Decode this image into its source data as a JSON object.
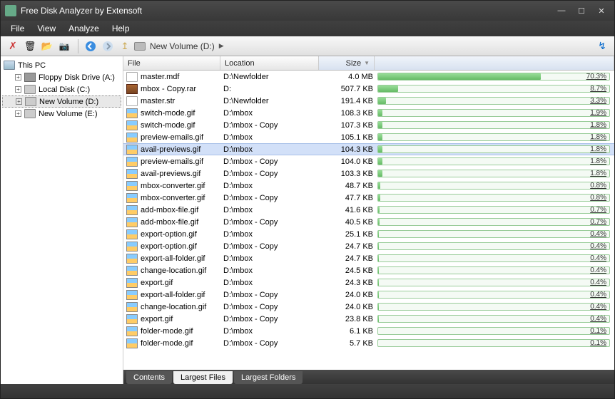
{
  "window": {
    "title": "Free Disk Analyzer by Extensoft"
  },
  "menu": {
    "file": "File",
    "view": "View",
    "analyze": "Analyze",
    "help": "Help"
  },
  "breadcrumb": {
    "path": "New Volume (D:)"
  },
  "tree": {
    "root": "This PC",
    "nodes": [
      {
        "label": "Floppy Disk Drive (A:)"
      },
      {
        "label": "Local Disk (C:)"
      },
      {
        "label": "New Volume (D:)"
      },
      {
        "label": "New Volume (E:)"
      }
    ]
  },
  "columns": {
    "file": "File",
    "location": "Location",
    "size": "Size"
  },
  "tabs": {
    "contents": "Contents",
    "largest_files": "Largest Files",
    "largest_folders": "Largest Folders"
  },
  "files": [
    {
      "icon": "doc",
      "name": "master.mdf",
      "location": "D:\\Newfolder",
      "size": "4.0 MB",
      "pct": 70.3
    },
    {
      "icon": "rar",
      "name": "mbox - Copy.rar",
      "location": "D:",
      "size": "507.7 KB",
      "pct": 8.7
    },
    {
      "icon": "doc",
      "name": "master.str",
      "location": "D:\\Newfolder",
      "size": "191.4 KB",
      "pct": 3.3
    },
    {
      "icon": "gif",
      "name": "switch-mode.gif",
      "location": "D:\\mbox",
      "size": "108.3 KB",
      "pct": 1.9
    },
    {
      "icon": "gif",
      "name": "switch-mode.gif",
      "location": "D:\\mbox - Copy",
      "size": "107.3 KB",
      "pct": 1.8
    },
    {
      "icon": "gif",
      "name": "preview-emails.gif",
      "location": "D:\\mbox",
      "size": "105.1 KB",
      "pct": 1.8
    },
    {
      "icon": "gif",
      "name": "avail-previews.gif",
      "location": "D:\\mbox",
      "size": "104.3 KB",
      "pct": 1.8,
      "selected": true
    },
    {
      "icon": "gif",
      "name": "preview-emails.gif",
      "location": "D:\\mbox - Copy",
      "size": "104.0 KB",
      "pct": 1.8
    },
    {
      "icon": "gif",
      "name": "avail-previews.gif",
      "location": "D:\\mbox - Copy",
      "size": "103.3 KB",
      "pct": 1.8
    },
    {
      "icon": "gif",
      "name": "mbox-converter.gif",
      "location": "D:\\mbox",
      "size": "48.7 KB",
      "pct": 0.8
    },
    {
      "icon": "gif",
      "name": "mbox-converter.gif",
      "location": "D:\\mbox - Copy",
      "size": "47.7 KB",
      "pct": 0.8
    },
    {
      "icon": "gif",
      "name": "add-mbox-file.gif",
      "location": "D:\\mbox",
      "size": "41.6 KB",
      "pct": 0.7
    },
    {
      "icon": "gif",
      "name": "add-mbox-file.gif",
      "location": "D:\\mbox - Copy",
      "size": "40.5 KB",
      "pct": 0.7
    },
    {
      "icon": "gif",
      "name": "export-option.gif",
      "location": "D:\\mbox",
      "size": "25.1 KB",
      "pct": 0.4
    },
    {
      "icon": "gif",
      "name": "export-option.gif",
      "location": "D:\\mbox - Copy",
      "size": "24.7 KB",
      "pct": 0.4
    },
    {
      "icon": "gif",
      "name": "export-all-folder.gif",
      "location": "D:\\mbox",
      "size": "24.7 KB",
      "pct": 0.4
    },
    {
      "icon": "gif",
      "name": "change-location.gif",
      "location": "D:\\mbox",
      "size": "24.5 KB",
      "pct": 0.4
    },
    {
      "icon": "gif",
      "name": "export.gif",
      "location": "D:\\mbox",
      "size": "24.3 KB",
      "pct": 0.4
    },
    {
      "icon": "gif",
      "name": "export-all-folder.gif",
      "location": "D:\\mbox - Copy",
      "size": "24.0 KB",
      "pct": 0.4
    },
    {
      "icon": "gif",
      "name": "change-location.gif",
      "location": "D:\\mbox - Copy",
      "size": "24.0 KB",
      "pct": 0.4
    },
    {
      "icon": "gif",
      "name": "export.gif",
      "location": "D:\\mbox - Copy",
      "size": "23.8 KB",
      "pct": 0.4
    },
    {
      "icon": "gif",
      "name": "folder-mode.gif",
      "location": "D:\\mbox",
      "size": "6.1 KB",
      "pct": 0.1
    },
    {
      "icon": "gif",
      "name": "folder-mode.gif",
      "location": "D:\\mbox - Copy",
      "size": "5.7 KB",
      "pct": 0.1
    }
  ]
}
